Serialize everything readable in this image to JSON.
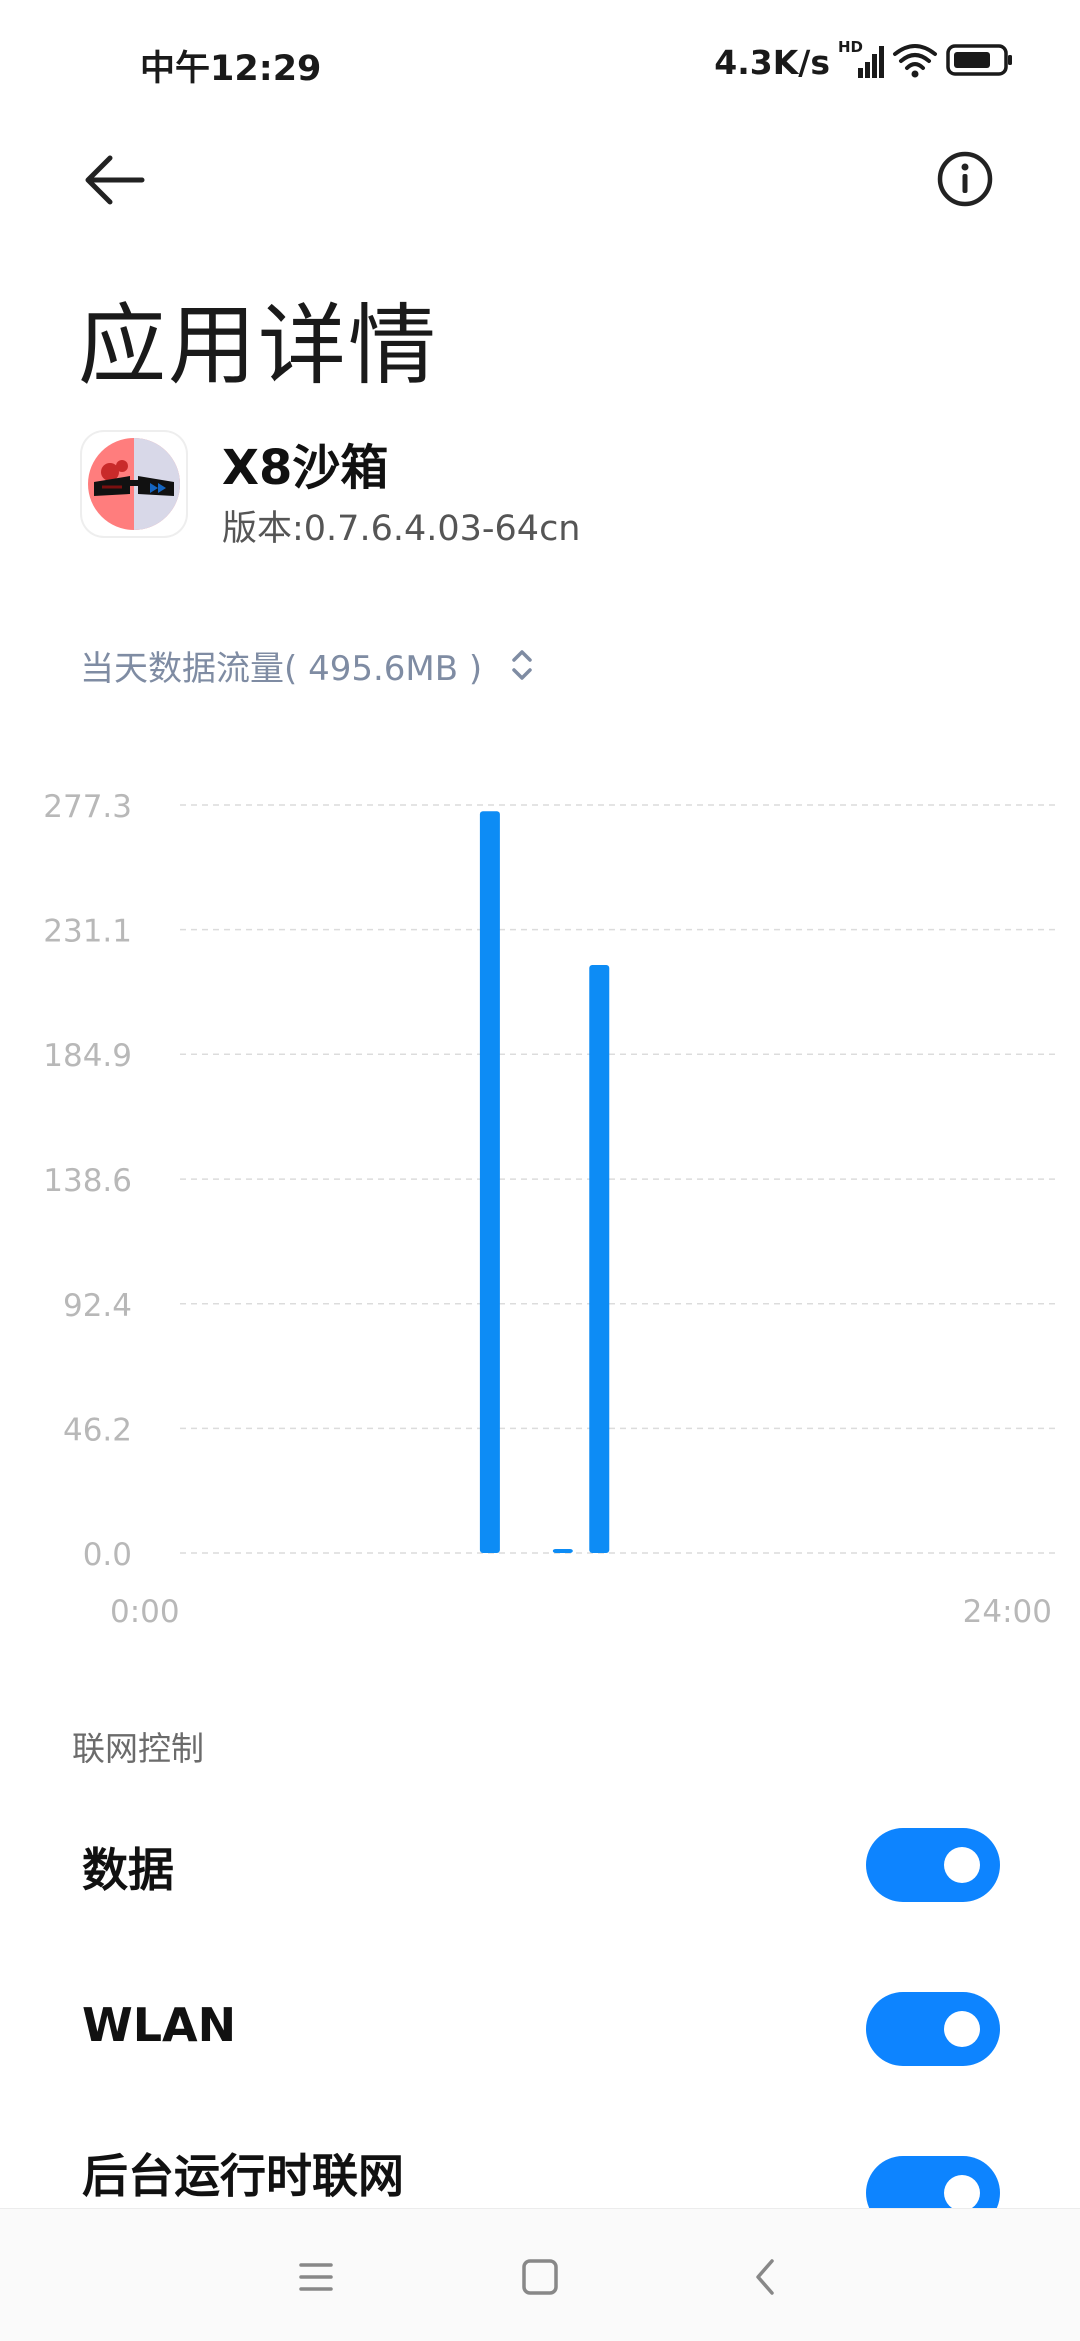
{
  "status_bar": {
    "time": "中午12:29",
    "net_speed": "4.3K/s",
    "hd_label": "HD",
    "icons": [
      "signal-icon",
      "wifi-icon",
      "battery-icon"
    ]
  },
  "header": {
    "back_icon": "back-arrow-icon",
    "info_icon": "info-icon"
  },
  "page_title": "应用详情",
  "app": {
    "name": "X8沙箱",
    "version": "版本:0.7.6.4.03-64cn"
  },
  "traffic": {
    "label": "当天数据流量(",
    "value": "495.6MB",
    "suffix": ")",
    "icon": "up-down-chevron-icon"
  },
  "chart_data": {
    "type": "bar",
    "series_color": "#0d8cf5",
    "y_ticks": [
      "277.3",
      "231.1",
      "184.9",
      "138.6",
      "92.4",
      "46.2",
      "0.0"
    ],
    "ylim": [
      0,
      277.3
    ],
    "x_ticks": [
      "0:00",
      "24:00"
    ],
    "xlim": [
      0,
      24
    ],
    "grid": true,
    "bars": [
      {
        "hour": 8.5,
        "value": 275
      },
      {
        "hour": 10.5,
        "value": 1.5
      },
      {
        "hour": 11.5,
        "value": 218
      }
    ]
  },
  "network_control": {
    "section_title": "联网控制",
    "items": [
      {
        "label": "数据",
        "enabled": true
      },
      {
        "label": "WLAN",
        "enabled": true
      },
      {
        "label": "后台运行时联网",
        "enabled": true
      }
    ]
  },
  "nav_bar": {
    "icons": [
      "menu-icon",
      "home-icon",
      "back-icon"
    ]
  }
}
